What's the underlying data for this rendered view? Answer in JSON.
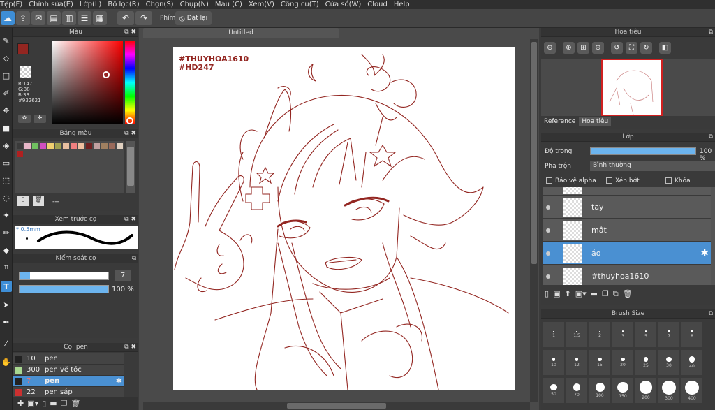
{
  "menu": [
    "Tệp(F)",
    "Chỉnh sửa(E)",
    "Lớp(L)",
    "Bộ lọc(R)",
    "Chọn(S)",
    "Chụp(N)",
    "Màu (C)",
    "Xem(V)",
    "Công cụ(T)",
    "Cửa sổ(W)",
    "Cloud",
    "Help"
  ],
  "toolbar": {
    "key_label": "Phím",
    "reset_label": "Đặt lại"
  },
  "color_panel": {
    "title": "Màu",
    "r": "R:147",
    "g": "G:38",
    "b": "B:33",
    "hex": "#932621",
    "current_color": "#932621"
  },
  "palette_panel": {
    "title": "Bảng màu",
    "dash": "---",
    "swatches": [
      "#3a3a3a",
      "#e7b7c8",
      "#70c060",
      "#d050c0",
      "#f0d070",
      "#a0a050",
      "#e9c0a0",
      "#f08080",
      "#f0c0a0",
      "#702020",
      "#c0a0a0",
      "#a08060",
      "#9a6a5a",
      "#e0d0c0",
      "#b02020"
    ]
  },
  "preview_panel": {
    "title": "Xem trước cọ",
    "size": "* 0.5mm"
  },
  "brush_control": {
    "title": "Kiểm soát cọ",
    "size_value": "7",
    "opacity": "100 %"
  },
  "brush_panel": {
    "title": "Cọ: pen",
    "items": [
      {
        "size": "10",
        "name": "pen",
        "color": "#222222"
      },
      {
        "size": "300",
        "name": "pen vẽ tóc",
        "color": "#a8d890"
      },
      {
        "size": "7",
        "name": "pen",
        "color": "#222222"
      },
      {
        "size": "22",
        "name": "pen sáp",
        "color": "#cc3030"
      }
    ]
  },
  "document": {
    "tab": "Untitled",
    "tag1": "#THUYHOA1610",
    "tag2": "#HD247",
    "line_color": "#932621"
  },
  "navigator": {
    "title": "Hoa tiêu",
    "tab_reference": "Reference",
    "tab_nav": "Hoa tiêu"
  },
  "layers_panel": {
    "title": "Lớp",
    "opacity_label": "Độ trong",
    "opacity_value": "100 %",
    "blend_label": "Pha trộn",
    "blend_value": "Bình thường",
    "protect_alpha": "Bảo vệ alpha",
    "clipping": "Xén bớt",
    "lock": "Khóa",
    "layers": [
      "tay",
      "mắt",
      "áo",
      "#thuyhoa1610"
    ]
  },
  "brush_size_panel": {
    "title": "Brush Size",
    "sizes": [
      "1",
      "1.5",
      "2",
      "3",
      "5",
      "7",
      "8",
      "10",
      "12",
      "15",
      "20",
      "25",
      "30",
      "40",
      "50",
      "70",
      "100",
      "150",
      "200",
      "300",
      "400"
    ]
  }
}
